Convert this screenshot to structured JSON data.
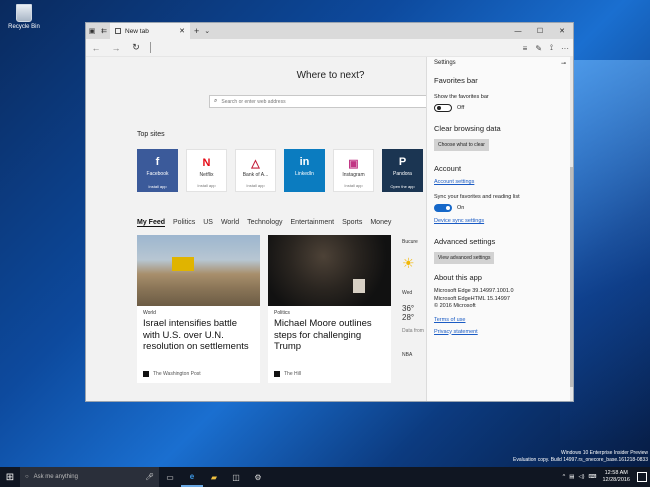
{
  "desktop": {
    "recycle_label": "Recycle Bin"
  },
  "browser": {
    "tab_title": "New tab",
    "new_tab_heading": "Where to next?",
    "search_placeholder": "Search or enter web address",
    "top_sites_heading": "Top sites",
    "top_sites": [
      {
        "name": "Facebook",
        "sub": "Install app",
        "glyph": "f",
        "style": "t-fb",
        "glyph_color": "#ffffff"
      },
      {
        "name": "Netflix",
        "sub": "Install app",
        "glyph": "N",
        "style": "t-light",
        "glyph_color": "#e50914"
      },
      {
        "name": "Bank of A...",
        "sub": "Install app",
        "glyph": "△",
        "style": "t-light",
        "glyph_color": "#c41e3a"
      },
      {
        "name": "LinkedIn",
        "sub": "",
        "glyph": "in",
        "style": "t-li",
        "glyph_color": "#ffffff"
      },
      {
        "name": "Instagram",
        "sub": "Install app",
        "glyph": "▣",
        "style": "t-light",
        "glyph_color": "#c13584"
      },
      {
        "name": "Pandora",
        "sub": "Open the app",
        "glyph": "P",
        "style": "t-pd",
        "glyph_color": "#ffffff"
      }
    ],
    "feed_tabs": [
      "My Feed",
      "Politics",
      "US",
      "World",
      "Technology",
      "Entertainment",
      "Sports",
      "Money"
    ],
    "cards": [
      {
        "category": "World",
        "headline": "Israel intensifies battle with U.S. over U.N. resolution on settlements",
        "source": "The Washington Post"
      },
      {
        "category": "Politics",
        "headline": "Michael Moore outlines steps for challenging Trump",
        "source": "The Hill"
      }
    ],
    "weather": {
      "city": "Bucure",
      "day": "Wed",
      "temp1": "36°",
      "temp2": "28°",
      "source": "Data from",
      "sport": "NBA"
    }
  },
  "settings": {
    "title": "Settings",
    "favorites_heading": "Favorites bar",
    "show_favorites_label": "Show the favorites bar",
    "show_favorites_state": "Off",
    "clear_heading": "Clear browsing data",
    "clear_button": "Choose what to clear",
    "account_heading": "Account",
    "account_link": "Account settings",
    "sync_label": "Sync your favorites and reading list",
    "sync_state": "On",
    "device_sync_link": "Device sync settings",
    "advanced_heading": "Advanced settings",
    "advanced_button": "View advanced settings",
    "about_heading": "About this app",
    "about_lines": [
      "Microsoft Edge 39.14997.1001.0",
      "Microsoft EdgeHTML 15.14997",
      "© 2016 Microsoft"
    ],
    "terms_link": "Terms of use",
    "privacy_link": "Privacy statement"
  },
  "watermark": {
    "line1": "Windows 10 Enterprise Insider Preview",
    "line2": "Evaluation copy. Build 14997.rs_onecore_base.161218-0833"
  },
  "taskbar": {
    "search_placeholder": "Ask me anything",
    "time": "12:58 AM",
    "date": "12/28/2016"
  }
}
